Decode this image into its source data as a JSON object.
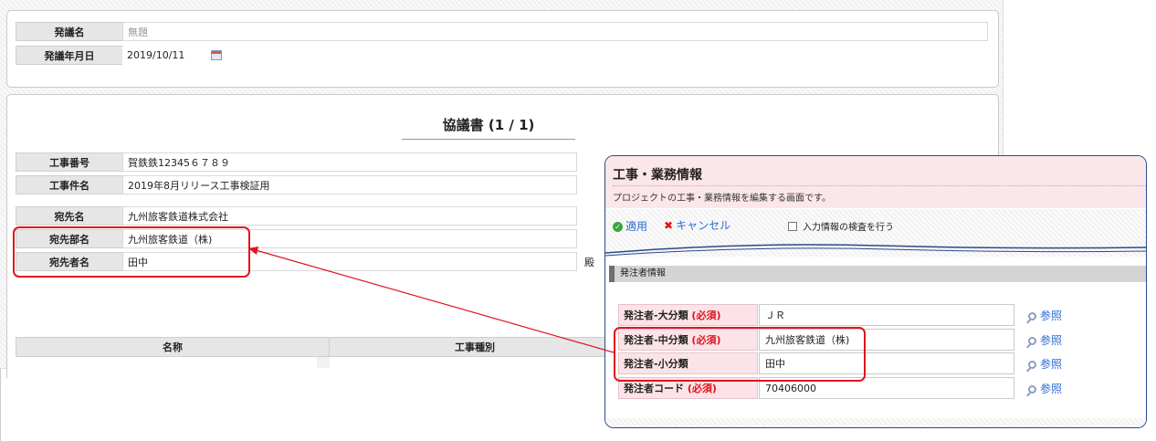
{
  "header_form": {
    "title_label": "発議名",
    "title_value": "無題",
    "date_label": "発議年月日",
    "date_value": "2019/10/11"
  },
  "document": {
    "title": "協議書 (1 / 1)",
    "rows1": [
      {
        "label": "工事番号",
        "value": "賀鉄鉄12345６７８９"
      },
      {
        "label": "工事件名",
        "value": "2019年8月リリース工事検証用"
      }
    ],
    "rows2": [
      {
        "label": "宛先名",
        "value": "九州旅客鉄道株式会社"
      },
      {
        "label": "宛先部名",
        "value": "九州旅客鉄道（株)"
      },
      {
        "label": "宛先者名",
        "value": "田中"
      }
    ],
    "honorific": "殿",
    "table_headers": [
      "名称",
      "工事種別"
    ]
  },
  "dialog": {
    "title": "工事・業務情報",
    "subtitle": "プロジェクトの工事・業務情報を編集する画面です。",
    "apply_label": "適用",
    "cancel_label": "キャンセル",
    "check_label": "入力情報の検査を行う",
    "section_title": "発注者情報",
    "required_mark": "(必須)",
    "fields": [
      {
        "label": "発注者-大分類",
        "required": "(必須)",
        "value": "ＪＲ",
        "ref": "参照"
      },
      {
        "label": "発注者-中分類",
        "required": "(必須)",
        "value": "九州旅客鉄道（株)",
        "ref": "参照"
      },
      {
        "label": "発注者-小分類",
        "required": "",
        "value": "田中",
        "ref": "参照"
      },
      {
        "label": "発注者コード",
        "required": "(必須)",
        "value": "70406000",
        "ref": "参照"
      }
    ]
  },
  "colors": {
    "highlight": "#e0141e",
    "link": "#2a6bd4",
    "dialog_header_bg": "#fbe6ea",
    "dialog_border": "#2a4a8a"
  }
}
